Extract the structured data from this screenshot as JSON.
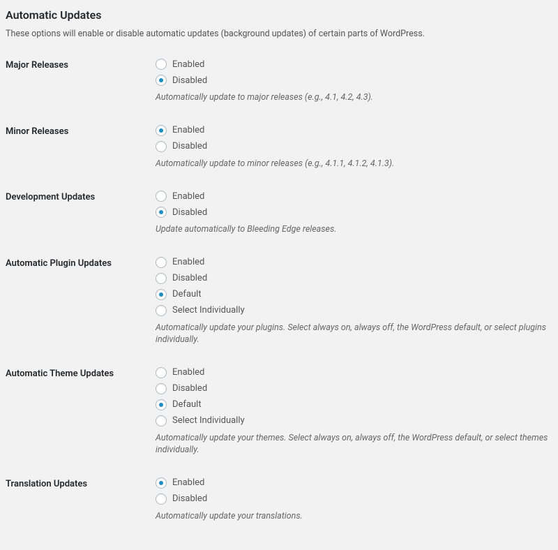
{
  "page": {
    "title": "Automatic Updates",
    "description": "These options will enable or disable automatic updates (background updates) of certain parts of WordPress."
  },
  "sections": {
    "major": {
      "label": "Major Releases",
      "options": {
        "enabled": "Enabled",
        "disabled": "Disabled"
      },
      "selected": "disabled",
      "desc": "Automatically update to major releases (e.g., 4.1, 4.2, 4.3)."
    },
    "minor": {
      "label": "Minor Releases",
      "options": {
        "enabled": "Enabled",
        "disabled": "Disabled"
      },
      "selected": "enabled",
      "desc": "Automatically update to minor releases (e.g., 4.1.1, 4.1.2, 4.1.3)."
    },
    "dev": {
      "label": "Development Updates",
      "options": {
        "enabled": "Enabled",
        "disabled": "Disabled"
      },
      "selected": "disabled",
      "desc": "Update automatically to Bleeding Edge releases."
    },
    "plugin": {
      "label": "Automatic Plugin Updates",
      "options": {
        "enabled": "Enabled",
        "disabled": "Disabled",
        "default": "Default",
        "select": "Select Individually"
      },
      "selected": "default",
      "desc": "Automatically update your plugins. Select always on, always off, the WordPress default, or select plugins individually."
    },
    "theme": {
      "label": "Automatic Theme Updates",
      "options": {
        "enabled": "Enabled",
        "disabled": "Disabled",
        "default": "Default",
        "select": "Select Individually"
      },
      "selected": "default",
      "desc": "Automatically update your themes. Select always on, always off, the WordPress default, or select themes individually."
    },
    "translation": {
      "label": "Translation Updates",
      "options": {
        "enabled": "Enabled",
        "disabled": "Disabled"
      },
      "selected": "enabled",
      "desc": "Automatically update your translations."
    }
  }
}
